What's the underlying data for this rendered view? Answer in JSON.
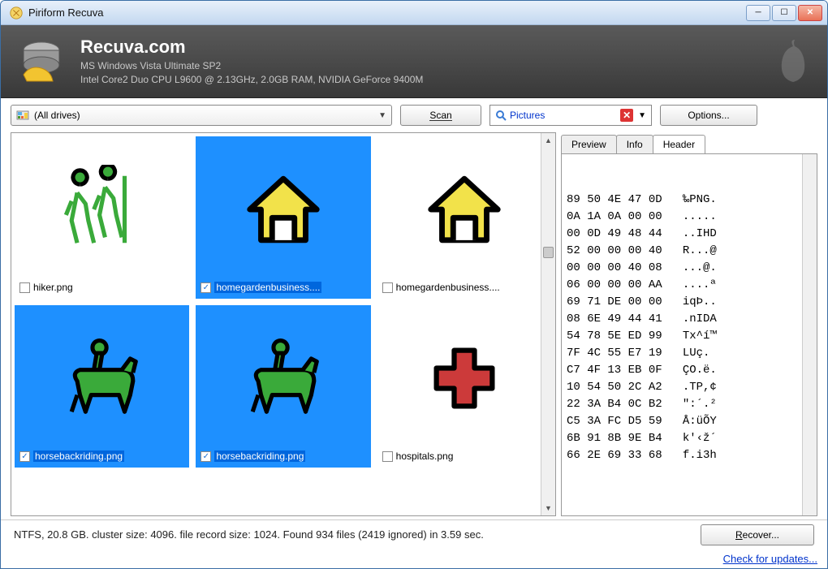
{
  "window": {
    "title": "Piriform Recuva"
  },
  "banner": {
    "title": "Recuva.com",
    "line1": "MS Windows Vista Ultimate SP2",
    "line2": "Intel Core2 Duo CPU L9600 @ 2.13GHz, 2.0GB RAM, NVIDIA GeForce 9400M"
  },
  "toolbar": {
    "drive_label": "(All drives)",
    "scan_label": "Scan",
    "filter_label": "Pictures",
    "options_label": "Options..."
  },
  "thumbnails": [
    {
      "name": "hiker.png",
      "selected": false,
      "checked": false,
      "icon": "hiker"
    },
    {
      "name": "homegardenbusiness....",
      "selected": true,
      "checked": true,
      "icon": "house-yellow"
    },
    {
      "name": "homegardenbusiness....",
      "selected": false,
      "checked": false,
      "icon": "house-yellow"
    },
    {
      "name": "horsebackriding.png",
      "selected": true,
      "checked": true,
      "icon": "horse"
    },
    {
      "name": "horsebackriding.png",
      "selected": true,
      "checked": true,
      "icon": "horse"
    },
    {
      "name": "hospitals.png",
      "selected": false,
      "checked": false,
      "icon": "cross"
    }
  ],
  "tabs": {
    "preview": "Preview",
    "info": "Info",
    "header": "Header",
    "active": "header"
  },
  "hex_lines": [
    "89 50 4E 47 0D   ‰PNG.",
    "0A 1A 0A 00 00   .....",
    "00 0D 49 48 44   ..IHD",
    "52 00 00 00 40   R...@",
    "00 00 00 40 08   ...@.",
    "06 00 00 00 AA   ....ª",
    "69 71 DE 00 00   iqÞ..",
    "08 6E 49 44 41   .nIDA",
    "54 78 5E ED 99   Tx^í™",
    "7F 4C 55 E7 19   LUç.",
    "C7 4F 13 EB 0F   ÇO.ë.",
    "10 54 50 2C A2   .TP,¢",
    "22 3A B4 0C B2   \":´.²",
    "C5 3A FC D5 59   Å:üÕY",
    "6B 91 8B 9E B4   k'‹ž´",
    "66 2E 69 33 68   f.i3h"
  ],
  "status": {
    "text": "NTFS, 20.8 GB. cluster size: 4096. file record size: 1024. Found 934 files (2419 ignored) in 3.59 sec.",
    "recover_label": "Recover..."
  },
  "footer": {
    "update_link": "Check for updates..."
  }
}
